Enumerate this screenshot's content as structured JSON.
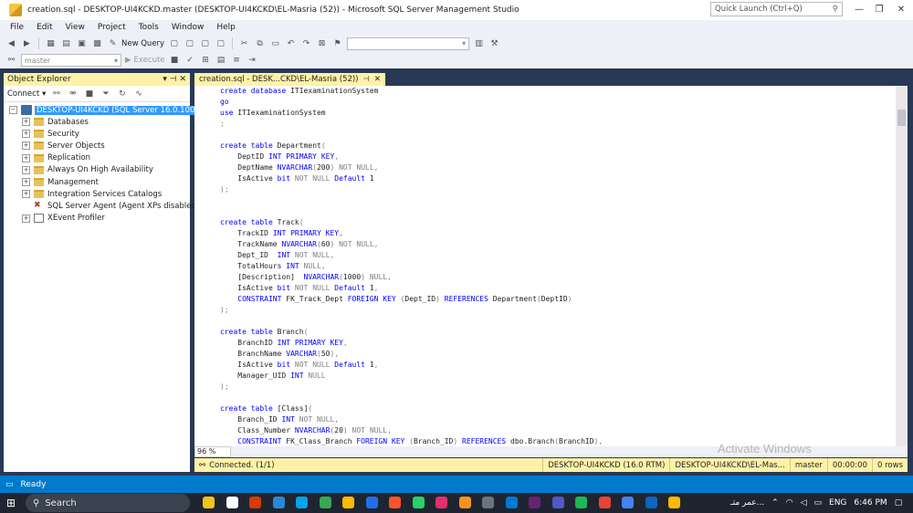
{
  "window": {
    "title": "creation.sql - DESKTOP-UI4KCKD.master (DESKTOP-UI4KCKD\\EL-Masria (52)) - Microsoft SQL Server Management Studio",
    "quick_launch_placeholder": "Quick Launch (Ctrl+Q)"
  },
  "menu": [
    "File",
    "Edit",
    "View",
    "Project",
    "Tools",
    "Window",
    "Help"
  ],
  "toolbar": {
    "new_query": "New Query",
    "database": "master",
    "execute": "Execute"
  },
  "object_explorer": {
    "title": "Object Explorer",
    "connect": "Connect",
    "server": "DESKTOP-UI4KCKD (SQL Server 16.0.1000.6 -",
    "nodes": [
      "Databases",
      "Security",
      "Server Objects",
      "Replication",
      "Always On High Availability",
      "Management",
      "Integration Services Catalogs",
      "SQL Server Agent (Agent XPs disabled)",
      "XEvent Profiler"
    ]
  },
  "editor": {
    "tab_label": "creation.sql - DESK...CKD\\EL-Masria (52))",
    "lines": [
      "create database ITIexaminationSystem",
      "go",
      "use ITIexaminationSystem",
      ";",
      "",
      "create table Department(",
      "    DeptID INT PRIMARY KEY,",
      "    DeptName NVARCHAR(200) NOT NULL,",
      "    IsActive bit NOT NULL Default 1",
      ");",
      "",
      "",
      "create table Track(",
      "    TrackID INT PRIMARY KEY,",
      "    TrackName NVARCHAR(60) NOT NULL,",
      "    Dept_ID  INT NOT NULL,",
      "    TotalHours INT NULL,",
      "    [Description]  NVARCHAR(1000) NULL,",
      "    IsActive bit NOT NULL Default 1,",
      "    CONSTRAINT FK_Track_Dept FOREIGN KEY (Dept_ID) REFERENCES Department(DeptID)",
      ");",
      "",
      "create table Branch(",
      "    BranchID INT PRIMARY KEY,",
      "    BranchName VARCHAR(50),",
      "    IsActive bit NOT NULL Default 1,",
      "    Manager_UID INT NULL",
      ");",
      "",
      "create table [Class](",
      "    Branch_ID INT NOT NULL,",
      "    Class_Number NVARCHAR(20) NOT NULL,",
      "    CONSTRAINT FK_Class_Branch FOREIGN KEY (Branch_ID) REFERENCES dbo.Branch(BranchID),"
    ],
    "zoom": "96 %"
  },
  "query_status": {
    "connected": "Connected. (1/1)",
    "server": "DESKTOP-UI4KCKD (16.0 RTM)",
    "login": "DESKTOP-UI4KCKD\\EL-Mas...",
    "database": "master",
    "elapsed": "00:00:00",
    "rows": "0 rows"
  },
  "watermark": "Activate Windows",
  "status": {
    "ready": "Ready"
  },
  "taskbar": {
    "search": "Search",
    "tray_lang": "ENG",
    "time": "6:46 PM",
    "weather": "عمر متـ..."
  }
}
